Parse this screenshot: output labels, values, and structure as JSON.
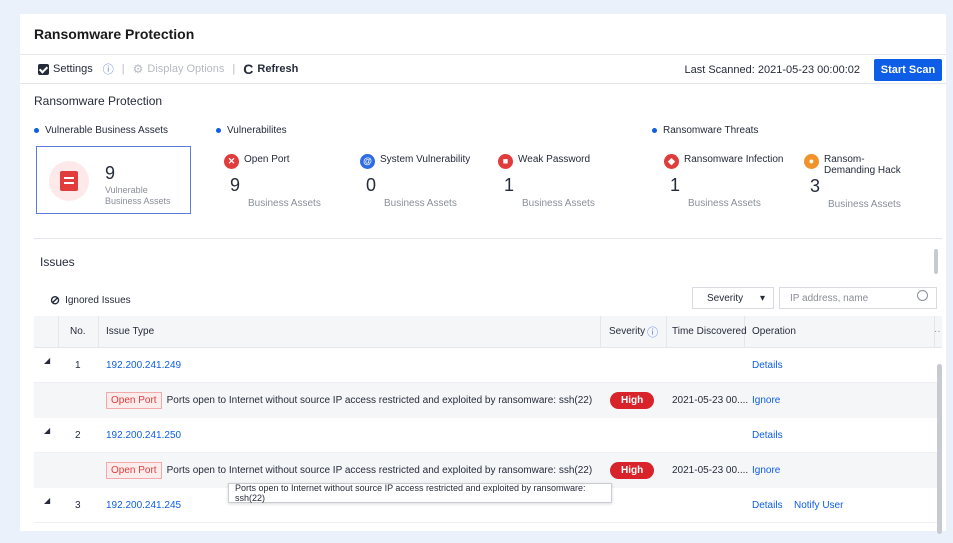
{
  "page_title": "Ransomware Protection",
  "toolbar": {
    "settings_label": "Settings",
    "separator": "|",
    "display_options_label": "Display Options",
    "refresh_label": "Refresh",
    "last_scanned": "Last Scanned: 2021-05-23 00:00:02",
    "start_scan_label": "Start Scan"
  },
  "section_title": "Ransomware Protection",
  "groups": {
    "vulnerable_assets": "Vulnerable Business Assets",
    "vulnerabilities": "Vulnerabilites",
    "threats": "Ransomware Threats"
  },
  "asset_card": {
    "count": "9",
    "label": "Vulnerable Business Assets"
  },
  "stats": [
    {
      "name": "Open Port",
      "count": "9",
      "sub": "Business Assets",
      "color": "#e23b3b",
      "icon": "close-icon"
    },
    {
      "name": "System Vulnerability",
      "count": "0",
      "sub": "Business Assets",
      "color": "#2e6be6",
      "icon": "at-icon"
    },
    {
      "name": "Weak Password",
      "count": "1",
      "sub": "Business Assets",
      "color": "#e23b3b",
      "icon": "lock-icon"
    },
    {
      "name": "Ransomware Infection",
      "count": "1",
      "sub": "Business Assets",
      "color": "#e23b3b",
      "icon": "shield-icon"
    },
    {
      "name": "Ransom-Demanding Hack",
      "count": "3",
      "sub": "Business Assets",
      "color": "#f2922a",
      "icon": "hacker-icon"
    }
  ],
  "issues": {
    "title": "Issues",
    "ignored_label": "Ignored Issues",
    "severity_select": "Severity",
    "search_placeholder": "IP address, name",
    "columns": {
      "no": "No.",
      "issue_type": "Issue Type",
      "severity": "Severity",
      "time": "Time Discovered",
      "operation": "Operation",
      "more": "··"
    },
    "rows": [
      {
        "no": "1",
        "ip": "192.200.241.249",
        "op1": "Details",
        "op2": ""
      },
      {
        "tag": "Open Port",
        "desc": "Ports open to Internet without source IP access restricted and exploited by ransomware: ssh(22)",
        "severity": "High",
        "time": "2021-05-23 00....",
        "op": "Ignore"
      },
      {
        "no": "2",
        "ip": "192.200.241.250",
        "op1": "Details",
        "op2": ""
      },
      {
        "tag": "Open Port",
        "desc": "Ports open to Internet without source IP access restricted and exploited by ransomware: ssh(22)",
        "severity": "High",
        "time": "2021-05-23 00....",
        "op": "Ignore"
      },
      {
        "no": "3",
        "ip": "192.200.241.245",
        "op1": "Details",
        "op2": "Notify User"
      }
    ],
    "tooltip": "Ports open to Internet without source IP access restricted and exploited by ransomware: ssh(22)"
  }
}
